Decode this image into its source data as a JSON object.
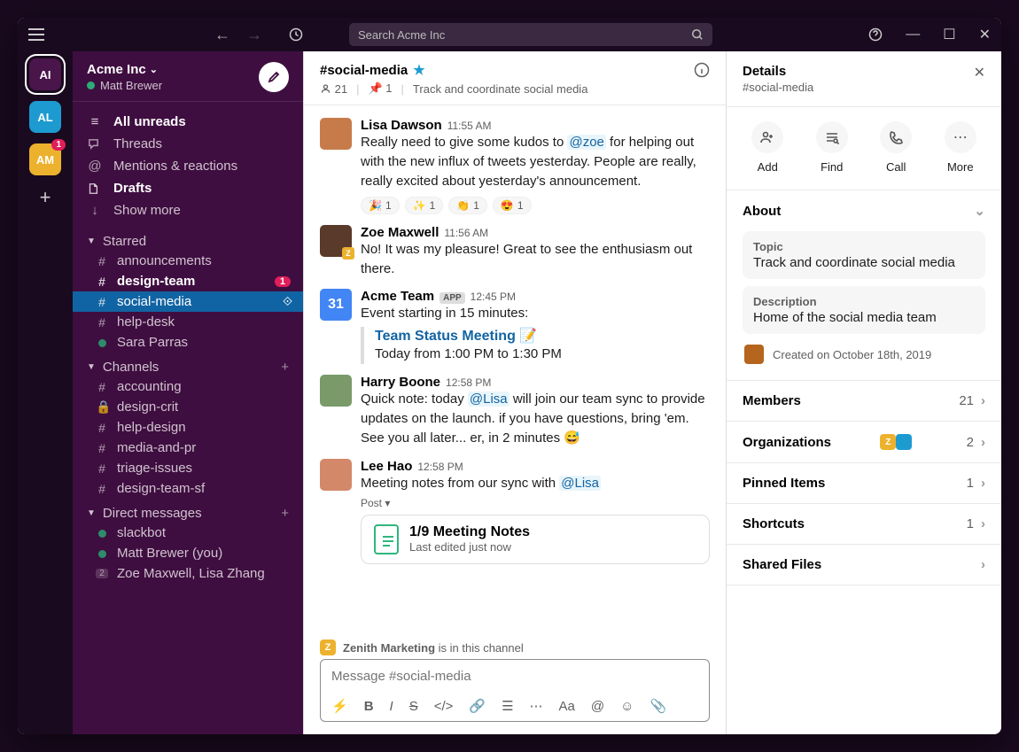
{
  "search_placeholder": "Search Acme Inc",
  "workspaces": [
    {
      "initials": "AI",
      "color": "#4a154b",
      "active": true,
      "badge": null
    },
    {
      "initials": "AL",
      "color": "#1d9bd1",
      "active": false,
      "badge": null
    },
    {
      "initials": "AM",
      "color": "#ecb22e",
      "active": false,
      "badge": "1"
    }
  ],
  "sidebar": {
    "workspace_name": "Acme Inc",
    "user_name": "Matt Brewer",
    "nav": {
      "all_unreads": "All unreads",
      "threads": "Threads",
      "mentions": "Mentions & reactions",
      "drafts": "Drafts",
      "show_more": "Show more"
    },
    "sections": {
      "starred": "Starred",
      "channels": "Channels",
      "dms": "Direct messages"
    },
    "starred": [
      {
        "prefix": "#",
        "name": "announcements",
        "bold": false
      },
      {
        "prefix": "#",
        "name": "design-team",
        "bold": true,
        "badge": "1"
      },
      {
        "prefix": "#",
        "name": "social-media",
        "bold": false,
        "active": true,
        "join": true
      },
      {
        "prefix": "#",
        "name": "help-desk",
        "bold": false
      },
      {
        "prefix": "●",
        "name": "Sara Parras",
        "bold": false,
        "presence": true
      }
    ],
    "channels": [
      {
        "prefix": "#",
        "name": "accounting"
      },
      {
        "prefix": "lock",
        "name": "design-crit"
      },
      {
        "prefix": "#",
        "name": "help-design"
      },
      {
        "prefix": "#",
        "name": "media-and-pr"
      },
      {
        "prefix": "#",
        "name": "triage-issues"
      },
      {
        "prefix": "#",
        "name": "design-team-sf"
      }
    ],
    "dms": [
      {
        "name": "slackbot",
        "presence": true
      },
      {
        "name": "Matt Brewer (you)",
        "presence": true
      },
      {
        "name": "Zoe Maxwell, Lisa Zhang",
        "count": "2"
      }
    ]
  },
  "channel": {
    "name": "#social-media",
    "members": "21",
    "pins": "1",
    "topic": "Track and coordinate social media"
  },
  "messages": [
    {
      "author": "Lisa Dawson",
      "time": "11:55 AM",
      "avatar": "#c77b4a",
      "segments": [
        {
          "t": "Really need to give some kudos to "
        },
        {
          "t": "@zoe",
          "m": true
        },
        {
          "t": " for helping out with the new influx of tweets yesterday. People are really, really excited about yesterday's announcement."
        }
      ],
      "reactions": [
        {
          "e": "🎉",
          "c": "1"
        },
        {
          "e": "✨",
          "c": "1"
        },
        {
          "e": "👏",
          "c": "1"
        },
        {
          "e": "😍",
          "c": "1"
        }
      ]
    },
    {
      "author": "Zoe Maxwell",
      "time": "11:56 AM",
      "avatar": "#5a3a2a",
      "zbadge": true,
      "segments": [
        {
          "t": "No! It was my pleasure! Great to see the enthusiasm out there."
        }
      ]
    },
    {
      "author": "Acme Team",
      "time": "12:45 PM",
      "avatar": "#4285f4",
      "app": true,
      "cal": true,
      "segments": [
        {
          "t": "Event starting in 15 minutes:"
        }
      ],
      "event": {
        "title": "Team Status Meeting 📝",
        "when": "Today from 1:00 PM to 1:30 PM"
      }
    },
    {
      "author": "Harry Boone",
      "time": "12:58 PM",
      "avatar": "#7a9a6a",
      "segments": [
        {
          "t": "Quick note: today "
        },
        {
          "t": "@Lisa",
          "m": true
        },
        {
          "t": " will join our team sync to provide updates on the launch. if you have questions, bring 'em. See you all later... er, in 2 minutes 😅"
        }
      ]
    },
    {
      "author": "Lee Hao",
      "time": "12:58 PM",
      "avatar": "#d4886a",
      "segments": [
        {
          "t": "Meeting notes from our sync with "
        },
        {
          "t": "@Lisa",
          "m": true
        }
      ],
      "post_label": "Post ▾",
      "post": {
        "title": "1/9 Meeting Notes",
        "sub": "Last edited just now"
      }
    }
  ],
  "banner": {
    "org": "Zenith Marketing",
    "text": " is in this channel"
  },
  "composer_placeholder": "Message #social-media",
  "details": {
    "title": "Details",
    "sub": "#social-media",
    "actions": {
      "add": "Add",
      "find": "Find",
      "call": "Call",
      "more": "More"
    },
    "about": {
      "heading": "About",
      "topic_label": "Topic",
      "topic": "Track and coordinate social media",
      "desc_label": "Description",
      "desc": "Home of the social media team",
      "created": "Created on October 18th, 2019"
    },
    "sections": {
      "members": {
        "label": "Members",
        "count": "21"
      },
      "orgs": {
        "label": "Organizations",
        "count": "2"
      },
      "pinned": {
        "label": "Pinned Items",
        "count": "1"
      },
      "shortcuts": {
        "label": "Shortcuts",
        "count": "1"
      },
      "files": {
        "label": "Shared Files",
        "count": ""
      }
    }
  },
  "app_label": "APP"
}
